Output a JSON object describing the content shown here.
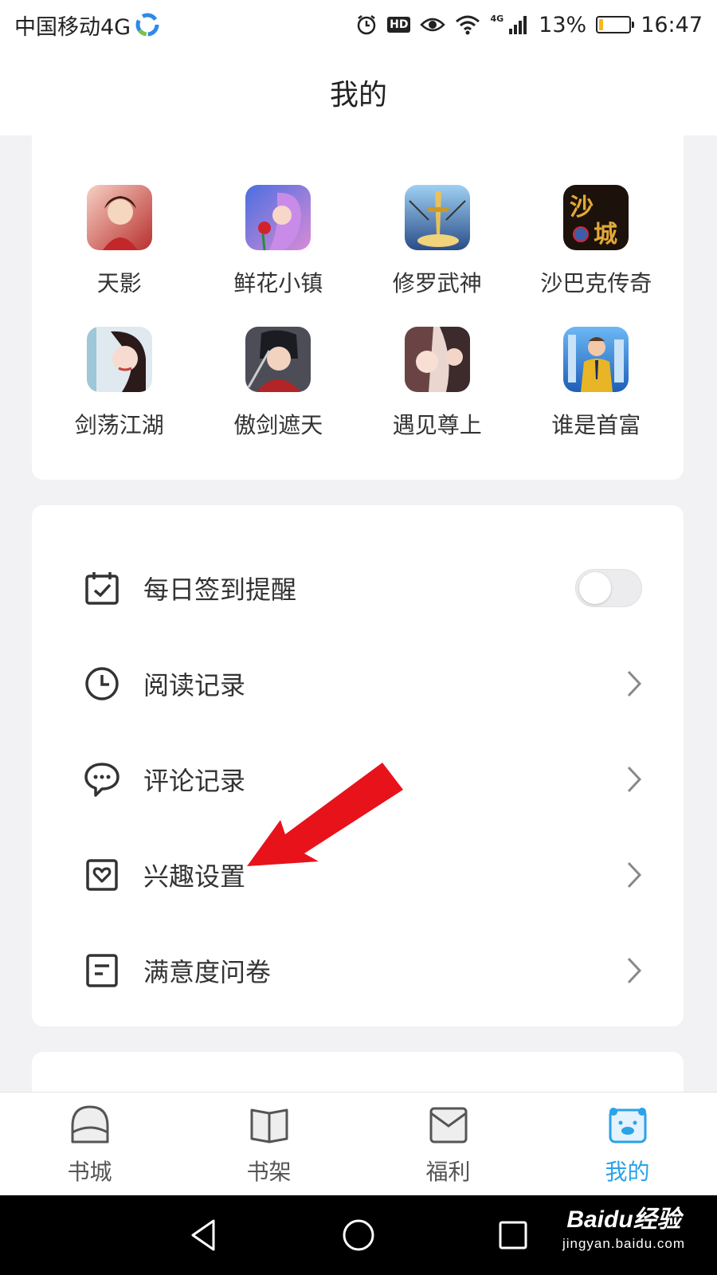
{
  "status_bar": {
    "carrier": "中国移动4G",
    "hd": "HD",
    "net": "4G",
    "battery_pct": "13%",
    "battery_level": 0.13,
    "time": "16:47"
  },
  "header": {
    "title": "我的"
  },
  "games": [
    {
      "name": "天影",
      "icon": "game-tianying-icon",
      "colors": [
        "#c9423c",
        "#f3c6a8"
      ]
    },
    {
      "name": "鲜花小镇",
      "icon": "game-xianhua-icon",
      "colors": [
        "#6a5bd8",
        "#d37ac9"
      ]
    },
    {
      "name": "修罗武神",
      "icon": "game-xiuluo-icon",
      "colors": [
        "#2d5fa8",
        "#e6c25a"
      ]
    },
    {
      "name": "沙巴克传奇",
      "icon": "game-shabake-icon",
      "colors": [
        "#1a120c",
        "#d8a23a"
      ]
    },
    {
      "name": "剑荡江湖",
      "icon": "game-jiandang-icon",
      "colors": [
        "#dbe6ee",
        "#c25b55"
      ]
    },
    {
      "name": "傲剑遮天",
      "icon": "game-aojian-icon",
      "colors": [
        "#3a3a44",
        "#b32a2a"
      ]
    },
    {
      "name": "遇见尊上",
      "icon": "game-yujian-icon",
      "colors": [
        "#8a6060",
        "#e8d0c8"
      ]
    },
    {
      "name": "谁是首富",
      "icon": "game-shouf-icon",
      "colors": [
        "#2b7fd8",
        "#e2b23a"
      ]
    }
  ],
  "menu": {
    "checkin": "每日签到提醒",
    "reading": "阅读记录",
    "comments": "评论记录",
    "interest": "兴趣设置",
    "survey": "满意度问卷"
  },
  "bottom_nav": {
    "bookstore": "书城",
    "bookshelf": "书架",
    "welfare": "福利",
    "mine": "我的"
  },
  "watermark": {
    "brand": "Baidu经验",
    "url": "jingyan.baidu.com"
  },
  "colors": {
    "accent": "#2aa3e8",
    "arrow": "#e8121b"
  }
}
